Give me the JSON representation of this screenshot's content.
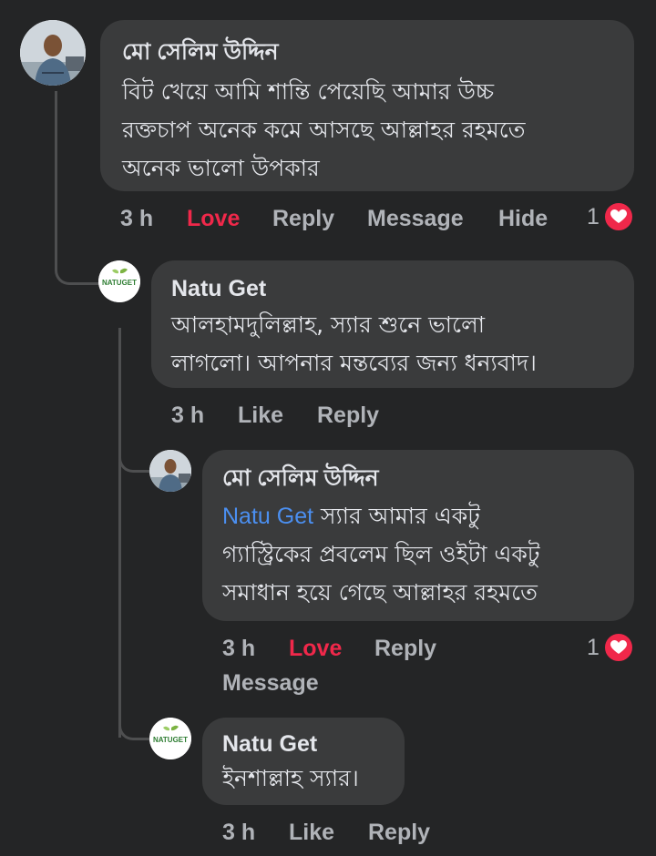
{
  "comments": [
    {
      "author": "মো সেলিম উদ্দিন",
      "avatar": "person-photo-icon",
      "text": [
        "বিট খেয়ে আমি শান্তি পেয়েছি আমার উচ্চ",
        "রক্তচাপ অনেক কমে আসছে আল্লাহর রহমতে",
        "অনেক ভালো উপকার"
      ],
      "time": "3 h",
      "actions": [
        "Love",
        "Reply",
        "Message",
        "Hide"
      ],
      "reaction_count": "1"
    },
    {
      "author": "Natu Get",
      "avatar": "natuget-logo",
      "avatar_text": "NATUGET",
      "text": [
        "আলহামদুলিল্লাহ, স্যার শুনে ভালো",
        "লাগলো। আপনার মন্তব্যের জন্য ধন্যবাদ।"
      ],
      "time": "3 h",
      "actions": [
        "Like",
        "Reply"
      ]
    },
    {
      "author": "মো সেলিম উদ্দিন",
      "avatar": "person-photo-icon",
      "mention": "Natu Get",
      "text": [
        "স্যার আমার একটু",
        "গ্যাস্ট্রিকের প্রবলেম ছিল ওইটা একটু",
        "সমাধান হয়ে গেছে আল্লাহর রহমতে"
      ],
      "time": "3 h",
      "actions": [
        "Love",
        "Reply",
        "Message"
      ],
      "reaction_count": "1"
    },
    {
      "author": "Natu Get",
      "avatar": "natuget-logo",
      "avatar_text": "NATUGET",
      "text": [
        "ইনশাল্লাহ স্যার।"
      ],
      "time": "3 h",
      "actions": [
        "Like",
        "Reply"
      ]
    }
  ],
  "colors": {
    "background": "#242526",
    "bubble": "#3a3b3c",
    "love": "#f0284a",
    "mention": "#4b8ff0",
    "secondary_text": "#b0b3b8"
  }
}
